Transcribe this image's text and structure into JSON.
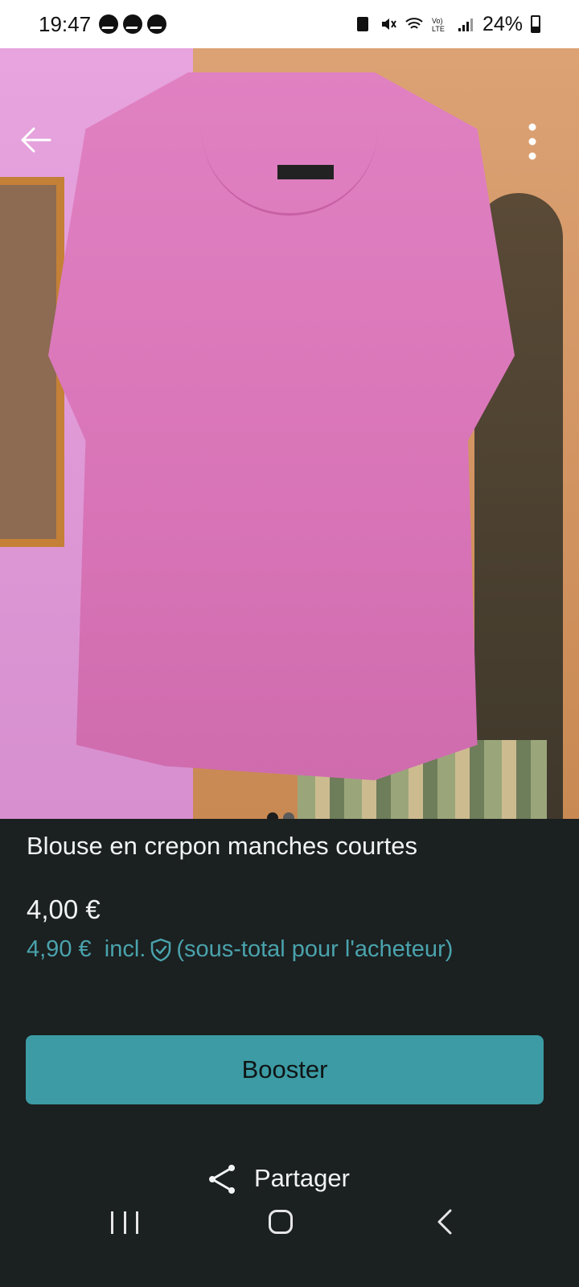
{
  "status_bar": {
    "time": "19:47",
    "notification_icons": [
      "messenger-icon",
      "messenger-icon",
      "messenger-icon"
    ],
    "battery": "24%"
  },
  "photo": {
    "page_dots": 2,
    "active_dot": 1
  },
  "listing": {
    "title": "Blouse en crepon manches courtes",
    "price": "4,00 €",
    "buyer_price": "4,90 €",
    "buyer_incl": "incl.",
    "buyer_note": "(sous-total pour l'acheteur)"
  },
  "actions": {
    "boost_label": "Booster",
    "share_label": "Partager"
  },
  "colors": {
    "accent": "#3c9ba4",
    "buyer_price": "#4aa3ad",
    "background": "#1b2020"
  }
}
